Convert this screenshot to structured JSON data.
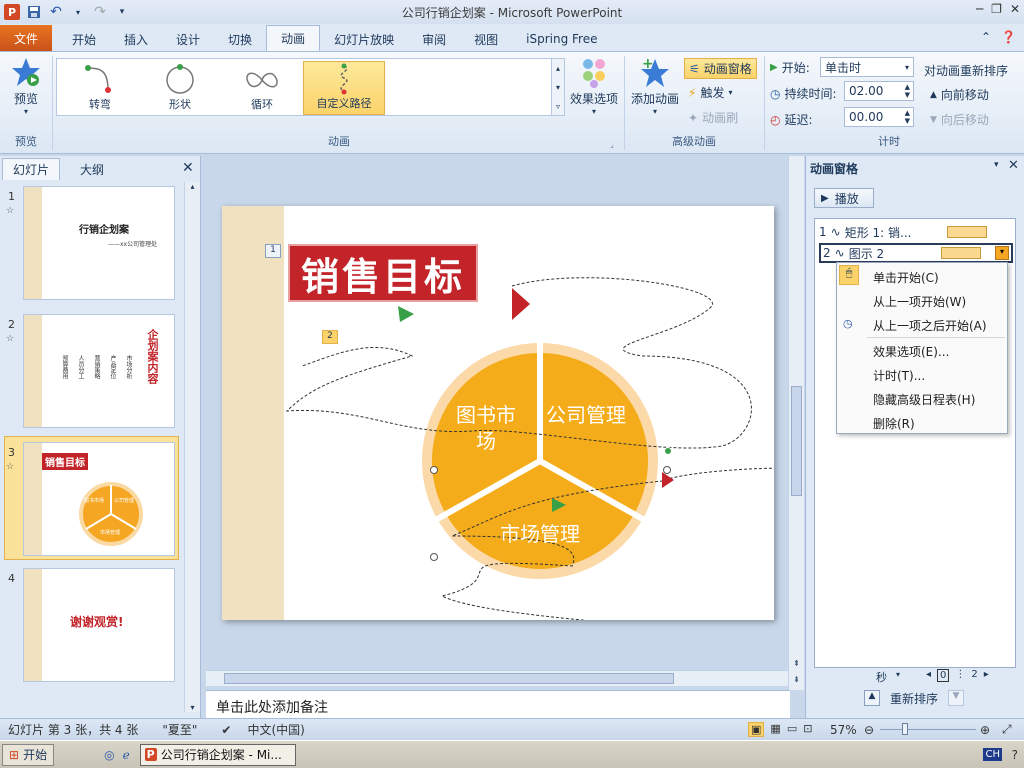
{
  "window": {
    "title": "公司行销企划案 - Microsoft PowerPoint"
  },
  "tabs": [
    "文件",
    "开始",
    "插入",
    "设计",
    "切换",
    "动画",
    "幻灯片放映",
    "审阅",
    "视图",
    "iSpring Free"
  ],
  "ribbon": {
    "preview": {
      "label": "预览",
      "group": "预览"
    },
    "gallery": [
      {
        "label": "转弯"
      },
      {
        "label": "形状"
      },
      {
        "label": "循环"
      },
      {
        "label": "自定义路径"
      }
    ],
    "effect_options": "效果选项",
    "group_animation": "动画",
    "add_animation": "添加动画",
    "anim_pane": "动画窗格",
    "trigger": "触发",
    "anim_painter": "动画刷",
    "group_advanced": "高级动画",
    "start_label": "开始:",
    "start_value": "单击时",
    "duration_label": "持续时间:",
    "duration_value": "02.00",
    "delay_label": "延迟:",
    "delay_value": "00.00",
    "group_timing": "计时",
    "reorder_title": "对动画重新排序",
    "move_earlier": "向前移动",
    "move_later": "向后移动"
  },
  "left_pane": {
    "tab_slides": "幻灯片",
    "tab_outline": "大纲",
    "slides": [
      {
        "num": "1",
        "title": "行销企划案",
        "subtitle": "——xx公司管理处"
      },
      {
        "num": "2",
        "title": "企划案内容",
        "items": [
          "市场分析",
          "产品定位",
          "营销策略",
          "人员分工",
          "预算费用"
        ]
      },
      {
        "num": "3",
        "title": "销售目标",
        "parts": [
          "图书市场",
          "公司管理",
          "市场管理"
        ]
      },
      {
        "num": "4",
        "title": "谢谢观赏!"
      }
    ]
  },
  "slide": {
    "title": "销售目标",
    "tag1": "1",
    "tag2": "2",
    "segments": [
      "图书市场",
      "公司管理",
      "市场管理"
    ]
  },
  "notes_placeholder": "单击此处添加备注",
  "anim_pane": {
    "title": "动画窗格",
    "play": "播放",
    "items": [
      {
        "num": "1",
        "label": "矩形 1: 销..."
      },
      {
        "num": "2",
        "label": "图示 2"
      }
    ],
    "menu": [
      "单击开始(C)",
      "从上一项开始(W)",
      "从上一项之后开始(A)",
      "效果选项(E)...",
      "计时(T)...",
      "隐藏高级日程表(H)",
      "删除(R)"
    ],
    "seconds": "秒",
    "timeline": [
      "0",
      "2"
    ],
    "reorder": "重新排序"
  },
  "status": {
    "slide_info": "幻灯片 第 3 张，共 4 张",
    "theme": "\"夏至\"",
    "language": "中文(中国)",
    "zoom": "57%"
  },
  "taskbar": {
    "start": "开始",
    "task": "公司行销企划案 - Mi...",
    "ime": "CH"
  }
}
